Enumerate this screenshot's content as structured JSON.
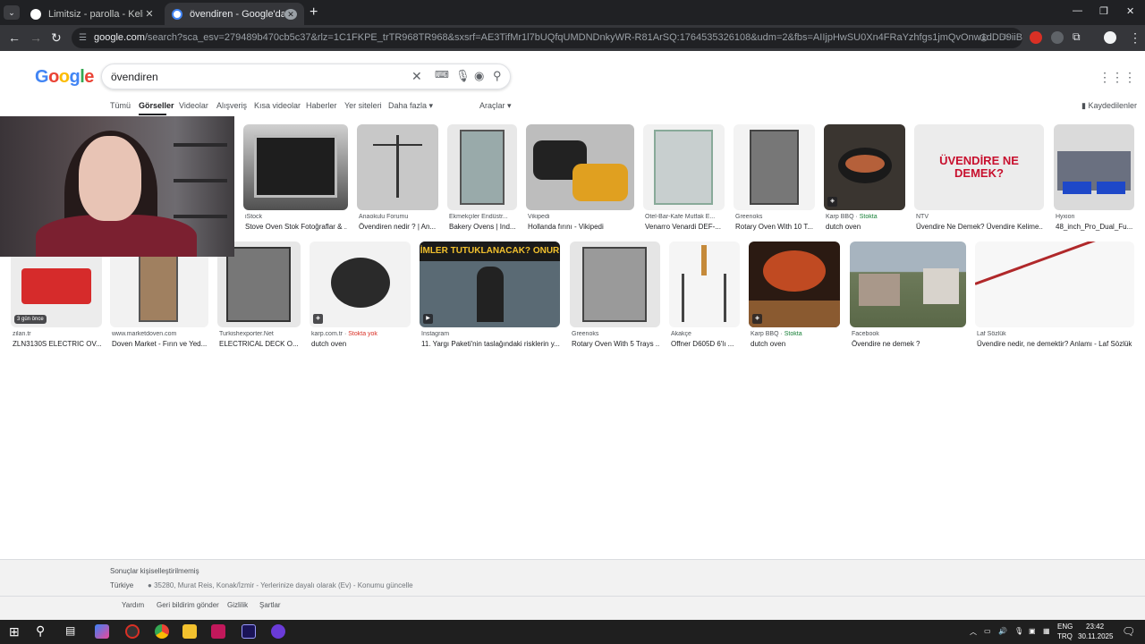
{
  "browser": {
    "tabs": [
      {
        "title": "Limitsiz - parolla - Kelime oyunu"
      },
      {
        "title": "övendiren - Google'da Ara"
      }
    ],
    "url_domain": "google.com",
    "url_path": "/search?sca_esv=279489b470cb5c37&rlz=1C1FKPE_trTR968TR968&sxsrf=AE3TifMr1l7bUQfqUMDNDnkyWR-R81ArSQ:1764535326108&udm=2&fbs=AIIjpHwSU0Xn4FRaYzhfgs1jmQvOnw1dDD9iiBuIB2fsjeHv6Rzi_t8nCYrA3VAY..."
  },
  "search": {
    "logo": "Google",
    "query": "övendiren",
    "tabs": [
      "Tümü",
      "Görseller",
      "Videolar",
      "Alışveriş",
      "Kısa videolar",
      "Haberler",
      "Yer siteleri",
      "Daha fazla"
    ],
    "tools": "Araçlar",
    "saved": "Kaydedilenler"
  },
  "results_row1": [
    {
      "source": "iStock",
      "title": "Stove Oven Stok Fotoğraflar & ..."
    },
    {
      "source": "Anaokulu Forumu",
      "title": "Övendiren nedir ? | An..."
    },
    {
      "source": "Ekmekçiler Endüstr...",
      "title": "Bakery Ovens | Ind..."
    },
    {
      "source": "Vikipedi",
      "title": "Hollanda fırını - Vikipedi"
    },
    {
      "source": "Otel-Bar-Kafe Mutfak E...",
      "title": "Venarro Venardi DEF-..."
    },
    {
      "source": "Greenoks",
      "title": "Rotary Oven With 10 T..."
    },
    {
      "source": "Karp BBQ",
      "stock": "Stokta",
      "title": "dutch oven"
    },
    {
      "source": "NTV",
      "title": "Üvendire Ne Demek? Üvendire Kelime...",
      "image_text": "ÜVENDİRE NE DEMEK?"
    },
    {
      "source": "Hyxion",
      "title": "48_inch_Pro_Dual_Fu..."
    }
  ],
  "results_row2": [
    {
      "source": "zilan.tr",
      "title": "ZLN3130S ELECTRIC OV...",
      "badge": "3 gün önce"
    },
    {
      "source": "www.marketdoven.com",
      "title": "Doven Market - Fırın ve Yed..."
    },
    {
      "source": "Turkishexporter.Net",
      "title": "ELECTRICAL DECK O..."
    },
    {
      "source": "karp.com.tr",
      "nostock": "Stokta yok",
      "title": "dutch oven"
    },
    {
      "source": "Instagram",
      "title": "11. Yargı Paketi'nin taslağındaki risklerin y...",
      "image_text": "İMLER TUTUKLANACAK? ONUR"
    },
    {
      "source": "Greenoks",
      "title": "Rotary Oven With 5 Trays ..."
    },
    {
      "source": "Akakçe",
      "title": "Offner D605D 6'lı ..."
    },
    {
      "source": "Karp BBQ",
      "stock": "Stokta",
      "title": "dutch oven"
    },
    {
      "source": "Facebook",
      "title": "Övendire ne demek ?"
    },
    {
      "source": "Laf Sözlük",
      "title": "Üvendire nedir, ne demektir? Anlamı - Laf Sözlük"
    }
  ],
  "footer": {
    "personalized": "Sonuçlar kişiselleştirilmemiş",
    "country": "Türkiye",
    "location": "35280, Murat Reis, Konak/İzmir",
    "location_note": "Yerlerinize dayalı olarak (Ev)",
    "update_location": "Konumu güncelle",
    "links": [
      "Yardım",
      "Geri bildirim gönder",
      "Gizlilik",
      "Şartlar"
    ]
  },
  "taskbar": {
    "lang1": "ENG",
    "lang2": "TRQ",
    "time": "23:42",
    "date": "30.11.2025"
  },
  "colors": {
    "accent_blue": "#1a0dab",
    "stock_green": "#188038",
    "nostock_red": "#d93025"
  }
}
